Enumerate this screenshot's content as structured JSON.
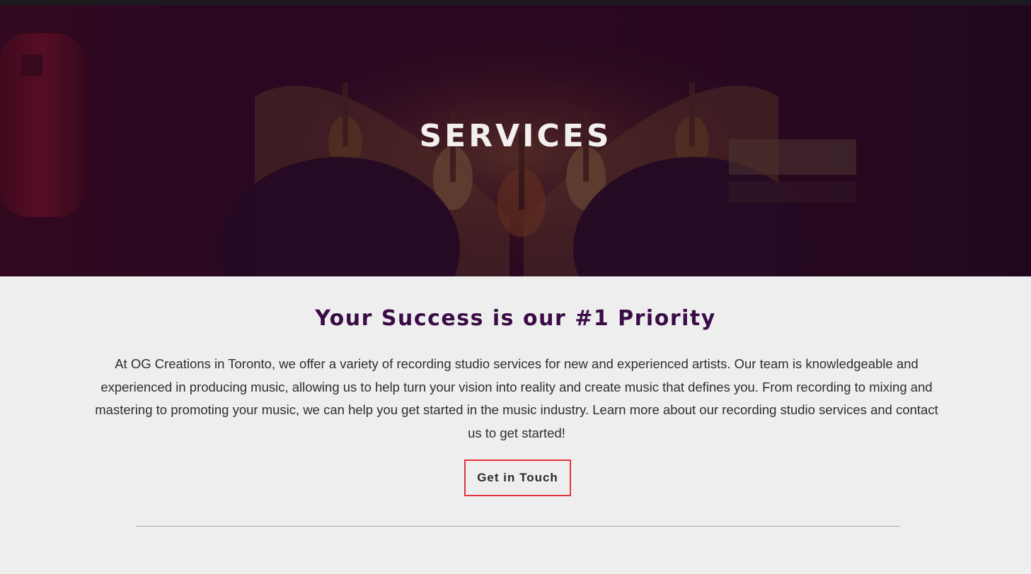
{
  "hero": {
    "title": "SERVICES"
  },
  "main": {
    "heading": "Your Success is our #1 Priority",
    "intro": "At OG Creations in Toronto, we offer a variety of recording studio services for new and experienced artists. Our team is knowledgeable and experienced in producing music, allowing us to help turn your vision into reality and create music that defines you. From recording to mixing and mastering to promoting your music, we can help you get started in the music industry. Learn more about our recording studio services and contact us to get started!",
    "cta_label": "Get in Touch"
  },
  "colors": {
    "heading": "#3a0c45",
    "cta_border": "#e3353e",
    "hero_overlay": "#2b0a1c",
    "page_background": "#eeeeee"
  }
}
